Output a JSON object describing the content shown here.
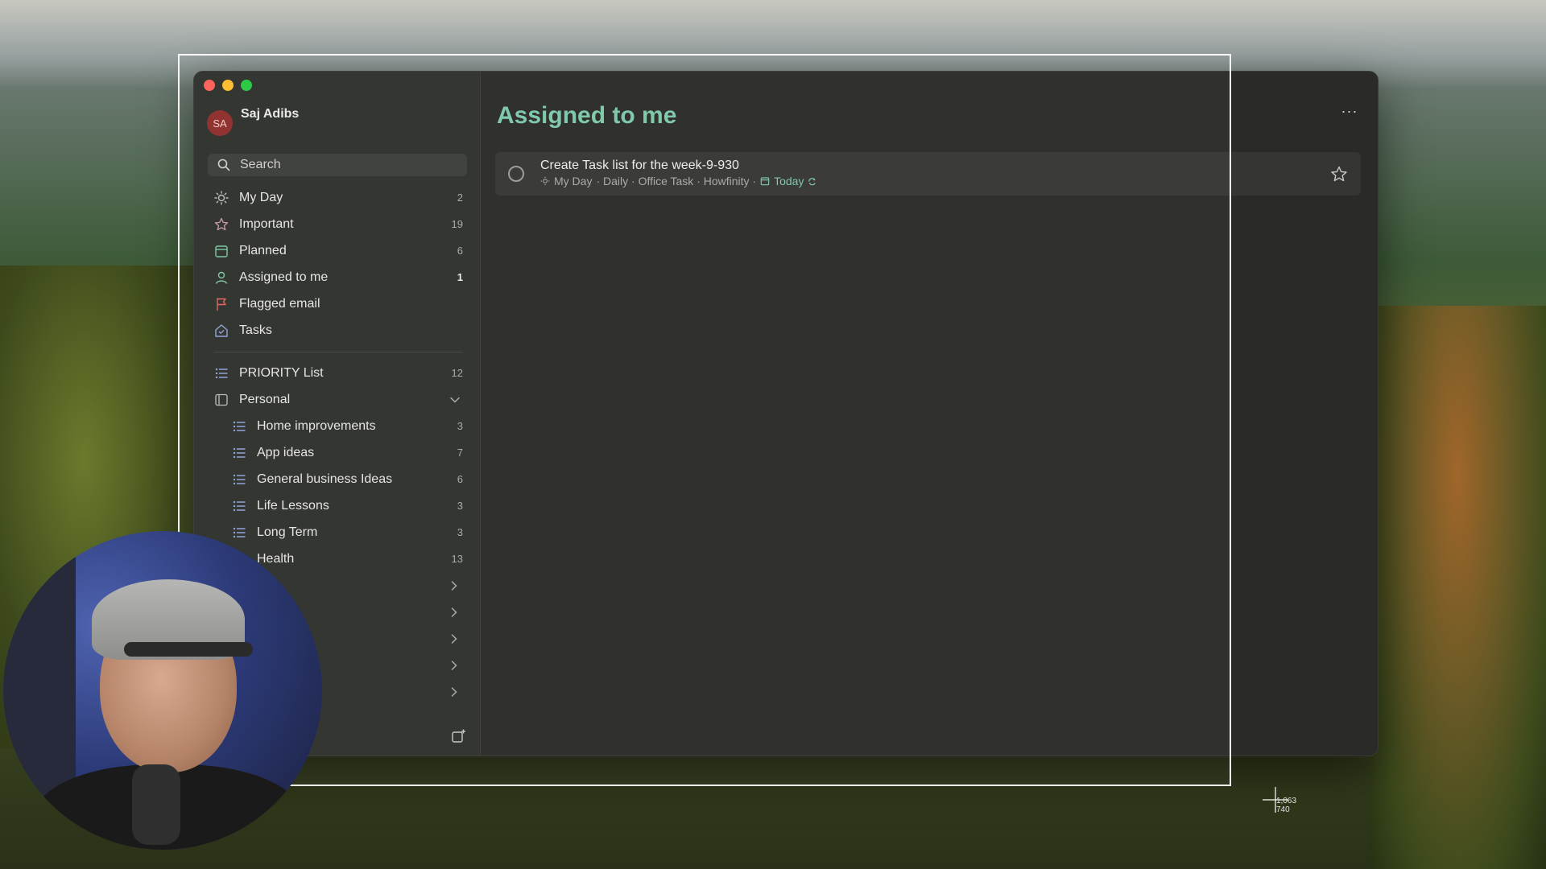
{
  "user": {
    "initials": "SA",
    "name": "Saj Adibs"
  },
  "search": {
    "placeholder": "Search"
  },
  "nav": {
    "smart_lists": [
      {
        "label": "My Day",
        "count": "2",
        "icon": "sun-icon"
      },
      {
        "label": "Important",
        "count": "19",
        "icon": "star-icon"
      },
      {
        "label": "Planned",
        "count": "6",
        "icon": "calendar-icon"
      },
      {
        "label": "Assigned to me",
        "count": "1",
        "icon": "person-icon",
        "active": true
      },
      {
        "label": "Flagged email",
        "count": "",
        "icon": "flag-icon"
      },
      {
        "label": "Tasks",
        "count": "",
        "icon": "home-icon"
      }
    ],
    "priority_list": {
      "label": "PRIORITY List",
      "count": "12"
    },
    "group": {
      "label": "Personal",
      "lists": [
        {
          "label": "Home improvements",
          "count": "3"
        },
        {
          "label": "App ideas",
          "count": "7"
        },
        {
          "label": "General business Ideas",
          "count": "6"
        },
        {
          "label": "Life Lessons",
          "count": "3"
        },
        {
          "label": "Long Term",
          "count": "3"
        },
        {
          "label": "Health",
          "count": "13"
        }
      ]
    }
  },
  "main": {
    "title": "Assigned to me",
    "more_label": "···",
    "tasks": [
      {
        "title": "Create Task list for the week-9-930",
        "meta_my_day": "My Day",
        "meta_rest": "· Daily · Office Task · Howfinity ·",
        "due": "Today"
      }
    ]
  },
  "cursor": {
    "readout_x": "1,063",
    "readout_y": "740"
  },
  "colors": {
    "accent": "#7cc8a8",
    "avatar_bg": "#8e2d2a",
    "close": "#fe5f57",
    "minimize": "#febc2e",
    "zoom": "#28c840"
  }
}
